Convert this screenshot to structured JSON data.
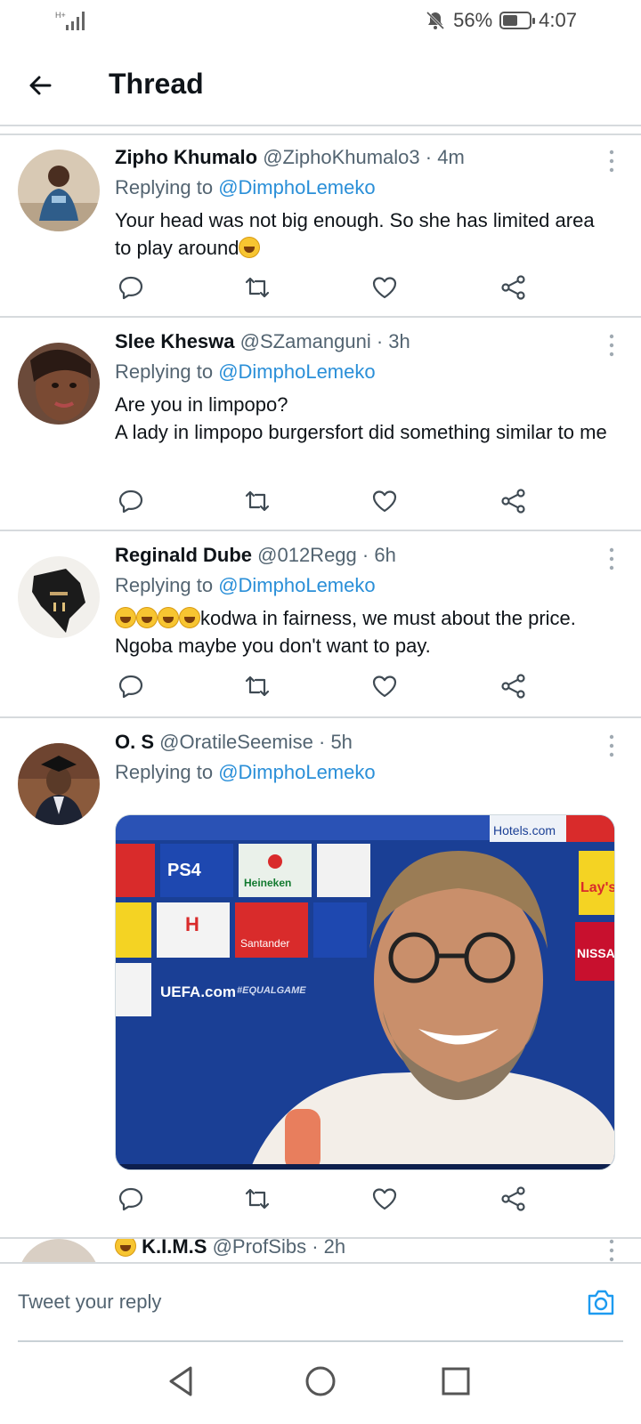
{
  "status_bar": {
    "network": "H+",
    "battery_percent": "56%",
    "battery_level": 0.56,
    "time": "4:07"
  },
  "header": {
    "title": "Thread"
  },
  "tweets": [
    {
      "name": "Zipho Khumalo",
      "handle": "@ZiphoKhumalo3",
      "age": "· 4m",
      "replying_prefix": "Replying to ",
      "replying_to": "@DimphoLemeko",
      "text": "Your head was not big enough. So she has limited area to play around"
    },
    {
      "name": "Slee Kheswa",
      "handle": "@SZamanguni",
      "age": "· 3h",
      "replying_prefix": "Replying to ",
      "replying_to": "@DimphoLemeko",
      "text_line1": "Are you in limpopo?",
      "text_line2": "A lady in limpopo burgersfort did something similar to me"
    },
    {
      "name": "Reginald Dube",
      "handle": "@012Regg",
      "age": "· 6h",
      "replying_prefix": "Replying to ",
      "replying_to": "@DimphoLemeko",
      "text": "kodwa in fairness, we must about the price. Ngoba maybe you don't want to pay."
    },
    {
      "name": "O. S",
      "handle": "@OratileSeemise",
      "age": "· 5h",
      "replying_prefix": "Replying to ",
      "replying_to": "@DimphoLemeko",
      "media_sponsor_labels": [
        "PS4",
        "Heineken",
        "Hotels.com",
        "Santander",
        "UEFA.com",
        "#EQUALGAME",
        "NISSAN",
        "Lay's"
      ]
    },
    {
      "name": "K.I.M.S",
      "handle": "@ProfSibs",
      "age": "· 2h"
    }
  ],
  "composer": {
    "placeholder": "Tweet your reply"
  },
  "icons": {
    "reply": "comment-icon",
    "retweet": "retweet-icon",
    "like": "heart-icon",
    "share": "share-icon",
    "more": "more-vertical-icon",
    "camera": "camera-icon"
  },
  "colors": {
    "link": "#2a8fd8",
    "divider": "#d6dadd",
    "secondary_text": "#536471"
  }
}
